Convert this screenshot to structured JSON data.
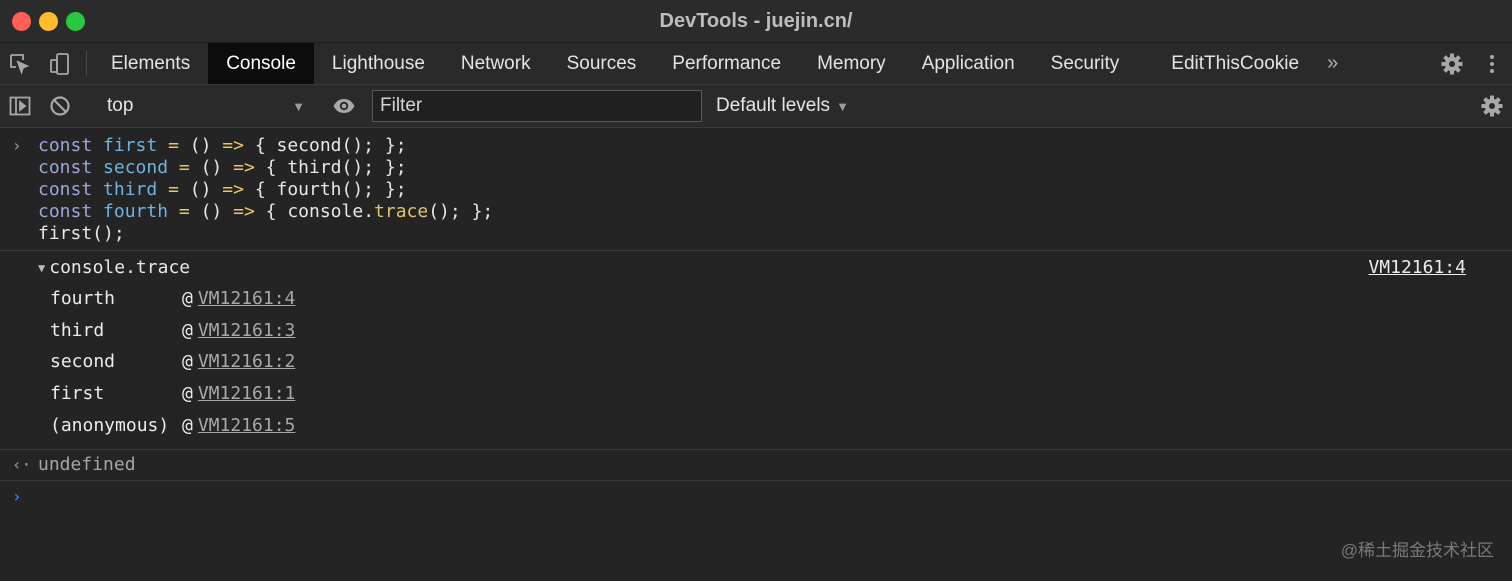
{
  "window": {
    "title": "DevTools - juejin.cn/"
  },
  "icons": {
    "inspect": "element-picker-icon",
    "device": "device-toolbar-icon",
    "settings": "gear-icon",
    "more": "vertical-ellipsis-icon",
    "sidebar": "sidebar-toggle-icon",
    "clear": "no-entry-icon",
    "eye": "eye-icon"
  },
  "tabs": [
    {
      "label": "Elements"
    },
    {
      "label": "Console",
      "active": true
    },
    {
      "label": "Lighthouse"
    },
    {
      "label": "Network"
    },
    {
      "label": "Sources"
    },
    {
      "label": "Performance"
    },
    {
      "label": "Memory"
    },
    {
      "label": "Application"
    },
    {
      "label": "Security"
    },
    {
      "label": "EditThisCookie"
    }
  ],
  "tab_overflow": "»",
  "toolbar": {
    "context": "top",
    "filter_placeholder": "Filter",
    "levels": "Default levels"
  },
  "console": {
    "input_prompt": "›",
    "code": {
      "l1": [
        "const",
        "first",
        "=",
        "()",
        "=>",
        "{ second(); };"
      ],
      "l2": [
        "const",
        "second",
        "=",
        "()",
        "=>",
        "{ third(); };"
      ],
      "l3": [
        "const",
        "third",
        "=",
        "()",
        "=>",
        "{ fourth(); };"
      ],
      "l4": [
        "const",
        "fourth",
        "=",
        "()",
        "=>",
        "{ console.",
        "trace",
        "(); };"
      ],
      "l5": "first();"
    },
    "trace": {
      "label": "console.trace",
      "source": "VM12161:4",
      "frames": [
        {
          "fn": "fourth",
          "at": "@",
          "loc": "VM12161:4"
        },
        {
          "fn": "third",
          "at": "@",
          "loc": "VM12161:3"
        },
        {
          "fn": "second",
          "at": "@",
          "loc": "VM12161:2"
        },
        {
          "fn": "first",
          "at": "@",
          "loc": "VM12161:1"
        },
        {
          "fn": "(anonymous)",
          "at": "@",
          "loc": "VM12161:5"
        }
      ]
    },
    "result_prompt": "‹·",
    "result": "undefined"
  },
  "watermark": "@稀土掘金技术社区",
  "colors": {
    "keyword": "#9aa8d8",
    "identifier": "#6fb3e0",
    "operator": "#e8c66a",
    "prompt_blue": "#3b82f6",
    "active_tab_bg": "#0c0c0c"
  }
}
